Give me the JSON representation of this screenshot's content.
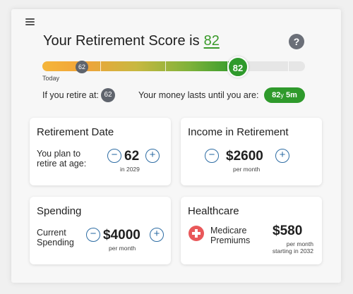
{
  "header": {
    "title": "Your Retirement Score is",
    "score": "82",
    "help_label": "?"
  },
  "progress": {
    "score_value": 82,
    "fill_fraction": 0.745,
    "today_marker": "62",
    "score_marker": "82",
    "today_label": "Today"
  },
  "summary": {
    "retire_label": "If you retire at:",
    "retire_age": "62",
    "lasts_label": "Your money lasts until you are:",
    "lasts_years": "82",
    "lasts_y": "y",
    "lasts_months": "5m"
  },
  "cards": {
    "retirement_date": {
      "title": "Retirement Date",
      "label_line1": "You plan to",
      "label_line2": "retire at age:",
      "value": "62",
      "sub": "in 2029",
      "minus": "−",
      "plus": "+"
    },
    "income": {
      "title": "Income in Retirement",
      "value": "$2600",
      "sub": "per month",
      "minus": "−",
      "plus": "+"
    },
    "spending": {
      "title": "Spending",
      "label_line1": "Current",
      "label_line2": "Spending",
      "value": "$4000",
      "sub": "per month",
      "minus": "−",
      "plus": "+"
    },
    "healthcare": {
      "title": "Healthcare",
      "label_line1": "Medicare",
      "label_line2": "Premiums",
      "value": "$580",
      "sub_line1": "per month",
      "sub_line2": "starting in 2032"
    }
  },
  "colors": {
    "accent_green": "#2f9a2c",
    "button_blue": "#2e6da4",
    "marker_gray": "#5f646d",
    "health_red": "#e9585a"
  },
  "icons": {
    "menu": "hamburger-menu-icon",
    "help": "help-icon",
    "health": "medical-cross-icon"
  }
}
